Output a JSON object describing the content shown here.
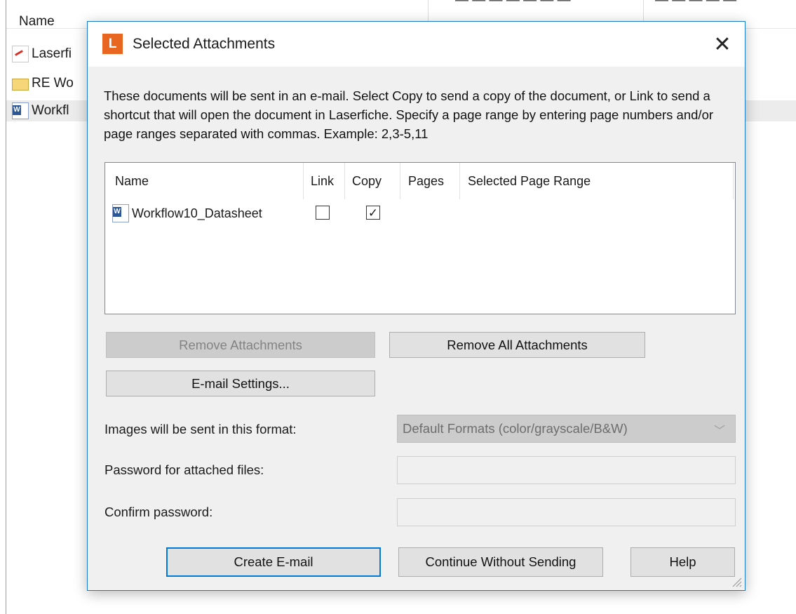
{
  "background": {
    "column_name": "Name",
    "column_cut_1": "— — — — — — —",
    "column_cut_2": "— — — — —",
    "rows": [
      "Laserfi",
      "RE  Wo",
      "Workfl"
    ]
  },
  "dialog": {
    "logo_letter": "L",
    "title": "Selected Attachments",
    "close_glyph": "✕",
    "instructions": "These documents will be sent in an e-mail. Select Copy to send a copy of the document, or Link to send a shortcut that will open the document in Laserfiche.  Specify a page range by entering page numbers and/or page ranges separated with commas.  Example: 2,3-5,11",
    "list": {
      "columns": [
        "Name",
        "Link",
        "Copy",
        "Pages",
        "Selected Page Range"
      ],
      "rows": [
        {
          "name": "Workflow10_Datasheet",
          "link": false,
          "copy": true,
          "pages": "",
          "range": ""
        }
      ]
    },
    "buttons": {
      "remove_attachments": "Remove Attachments",
      "remove_all": "Remove All Attachments",
      "email_settings": "E-mail Settings...",
      "create_email": "Create E-mail",
      "continue": "Continue Without Sending",
      "help": "Help"
    },
    "format_label": "Images will be sent in this format:",
    "format_value": "Default Formats (color/grayscale/B&W)",
    "password_label": "Password for attached files:",
    "confirm_label": "Confirm password:",
    "password_value": "",
    "confirm_value": ""
  },
  "colors": {
    "accent": "#0078d7",
    "logo": "#e8661f",
    "dialog_border": "#1979ca"
  }
}
